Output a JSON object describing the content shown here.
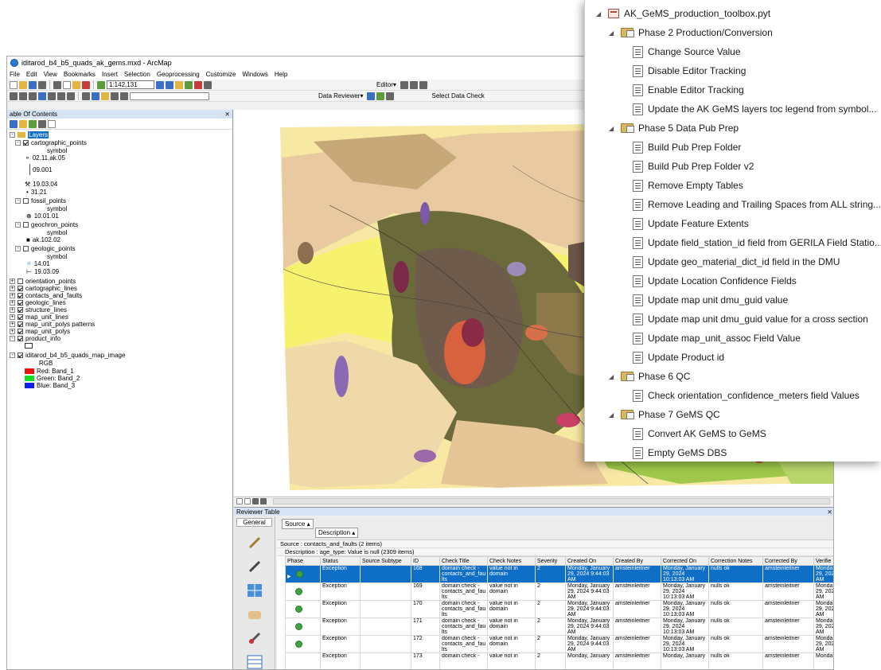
{
  "window": {
    "title": "iditarod_b4_b5_quads_ak_gems.mxd - ArcMap"
  },
  "menu": [
    "File",
    "Edit",
    "View",
    "Bookmarks",
    "Insert",
    "Selection",
    "Geoprocessing",
    "Customize",
    "Windows",
    "Help"
  ],
  "toolbar": {
    "scale": "1:142,131",
    "editor_label": "Editor▾",
    "data_reviewer_label": "Data Reviewer▾",
    "select_data_check": "Select Data Check"
  },
  "toc": {
    "title": "able Of Contents",
    "rows": [
      {
        "text": "Layers"
      },
      {
        "text": "cartographic_points"
      },
      {
        "text": "symbol"
      },
      {
        "text": "02.11.ak.05"
      },
      {
        "text": "09.001"
      },
      {
        "text": "19.03.04"
      },
      {
        "text": "31.21"
      },
      {
        "text": "fossil_points"
      },
      {
        "text": "symbol"
      },
      {
        "text": "10.01.01"
      },
      {
        "text": "geochron_points"
      },
      {
        "text": "symbol"
      },
      {
        "text": "ak.102.02"
      },
      {
        "text": "geologic_points"
      },
      {
        "text": "symbol"
      },
      {
        "text": "14.01"
      },
      {
        "text": "19.03.09"
      },
      {
        "text": "orientation_points"
      },
      {
        "text": "cartographic_lines"
      },
      {
        "text": "contacts_and_faults"
      },
      {
        "text": "geologic_lines"
      },
      {
        "text": "structure_lines"
      },
      {
        "text": "map_unit_lines"
      },
      {
        "text": "map_unit_polys patterns"
      },
      {
        "text": "map_unit_polys"
      },
      {
        "text": "product_info"
      },
      {
        "text": "iditarod_b4_b5_quads_map_image"
      },
      {
        "text": "RGB"
      },
      {
        "text": "Red:  Band_1"
      },
      {
        "text": "Green: Band_2"
      },
      {
        "text": "Blue:  Band_3"
      }
    ]
  },
  "reviewer": {
    "title": "Reviewer Table",
    "general_tab": "General",
    "group_source": "Source",
    "group_description": "Description",
    "grp1": "Source : contacts_and_faults (2 items)",
    "grp2": "Description : age_type: Value is null (2309 items)",
    "columns": [
      "Phase",
      "Status",
      "Source Subtype",
      "ID",
      "Check Title",
      "Check Notes",
      "Severity",
      "Created On",
      "Created By",
      "Corrected On",
      "Correction Notes",
      "Corrected By",
      "Verifie"
    ],
    "rows": [
      {
        "status": "Exception",
        "id": "168",
        "title": "domain check - contacts_and_fau lts",
        "notes": "value not in domain",
        "sev": "2",
        "created": "Monday, January 29, 2024 9:44:03 AM",
        "by": "amsteinleitner",
        "corrected": "Monday, January 29, 2024 10:13:03 AM",
        "cnotes": "nulls ok",
        "cby": "amsteinleitner",
        "ver": "Monda 29, 202 AM"
      },
      {
        "status": "Exception",
        "id": "169",
        "title": "domain check - contacts_and_fau lts",
        "notes": "value not in domain",
        "sev": "2",
        "created": "Monday, January 29, 2024 9:44:03 AM",
        "by": "amsteinleitner",
        "corrected": "Monday, January 29, 2024 10:13:03 AM",
        "cnotes": "nulls ok",
        "cby": "amsteinleitner",
        "ver": "Monda 29, 202 AM"
      },
      {
        "status": "Exception",
        "id": "170",
        "title": "domain check - contacts_and_fau lts",
        "notes": "value not in domain",
        "sev": "2",
        "created": "Monday, January 29, 2024 9:44:03 AM",
        "by": "amsteinleitner",
        "corrected": "Monday, January 29, 2024 10:13:03 AM",
        "cnotes": "nulls ok",
        "cby": "amsteinleitner",
        "ver": "Monda 29, 202 AM"
      },
      {
        "status": "Exception",
        "id": "171",
        "title": "domain check - contacts_and_fau lts",
        "notes": "value not in domain",
        "sev": "2",
        "created": "Monday, January 29, 2024 9:44:03 AM",
        "by": "amsteinleitner",
        "corrected": "Monday, January 29, 2024 10:13:03 AM",
        "cnotes": "nulls ok",
        "cby": "amsteinleitner",
        "ver": "Monda 29, 202 AM"
      },
      {
        "status": "Exception",
        "id": "172",
        "title": "domain check - contacts_and_fau lts",
        "notes": "value not in domain",
        "sev": "2",
        "created": "Monday, January 29, 2024 9:44:03 AM",
        "by": "amsteinleitner",
        "corrected": "Monday, January 29, 2024 10:13:03 AM",
        "cnotes": "nulls ok",
        "cby": "amsteinleitner",
        "ver": "Monda 29, 202 AM"
      },
      {
        "status": "Exception",
        "id": "173",
        "title": "domain check -",
        "notes": "value not in",
        "sev": "2",
        "created": "Monday, January",
        "by": "amsteinleitner",
        "corrected": "Monday, January",
        "cnotes": "nulls ok",
        "cby": "amsteinleitner",
        "ver": "Monda"
      }
    ]
  },
  "catalog": {
    "items": [
      {
        "text": "AK_GeMS_production_toolbox.pyt"
      },
      {
        "text": "Phase 2 Production/Conversion"
      },
      {
        "text": "Change Source Value"
      },
      {
        "text": "Disable Editor Tracking"
      },
      {
        "text": "Enable Editor Tracking"
      },
      {
        "text": "Update the AK GeMS layers toc legend from symbol..."
      },
      {
        "text": "Phase 5 Data Pub Prep"
      },
      {
        "text": "Build Pub Prep Folder"
      },
      {
        "text": "Build Pub Prep Folder v2"
      },
      {
        "text": "Remove Empty Tables"
      },
      {
        "text": "Remove Leading and Trailing Spaces from ALL string..."
      },
      {
        "text": "Update Feature Extents"
      },
      {
        "text": "Update field_station_id field from GERILA Field Statio..."
      },
      {
        "text": "Update geo_material_dict_id field in the DMU"
      },
      {
        "text": "Update Location Confidence Fields"
      },
      {
        "text": "Update map unit dmu_guid value"
      },
      {
        "text": "Update map unit dmu_guid value for a cross section"
      },
      {
        "text": "Update map_unit_assoc Field Value"
      },
      {
        "text": "Update Product id"
      },
      {
        "text": "Phase 6 QC"
      },
      {
        "text": "Check orientation_confidence_meters field Values"
      },
      {
        "text": "Phase 7 GeMS QC"
      },
      {
        "text": "Convert AK GeMS to GeMS"
      },
      {
        "text": "Empty GeMS DBS"
      }
    ]
  }
}
